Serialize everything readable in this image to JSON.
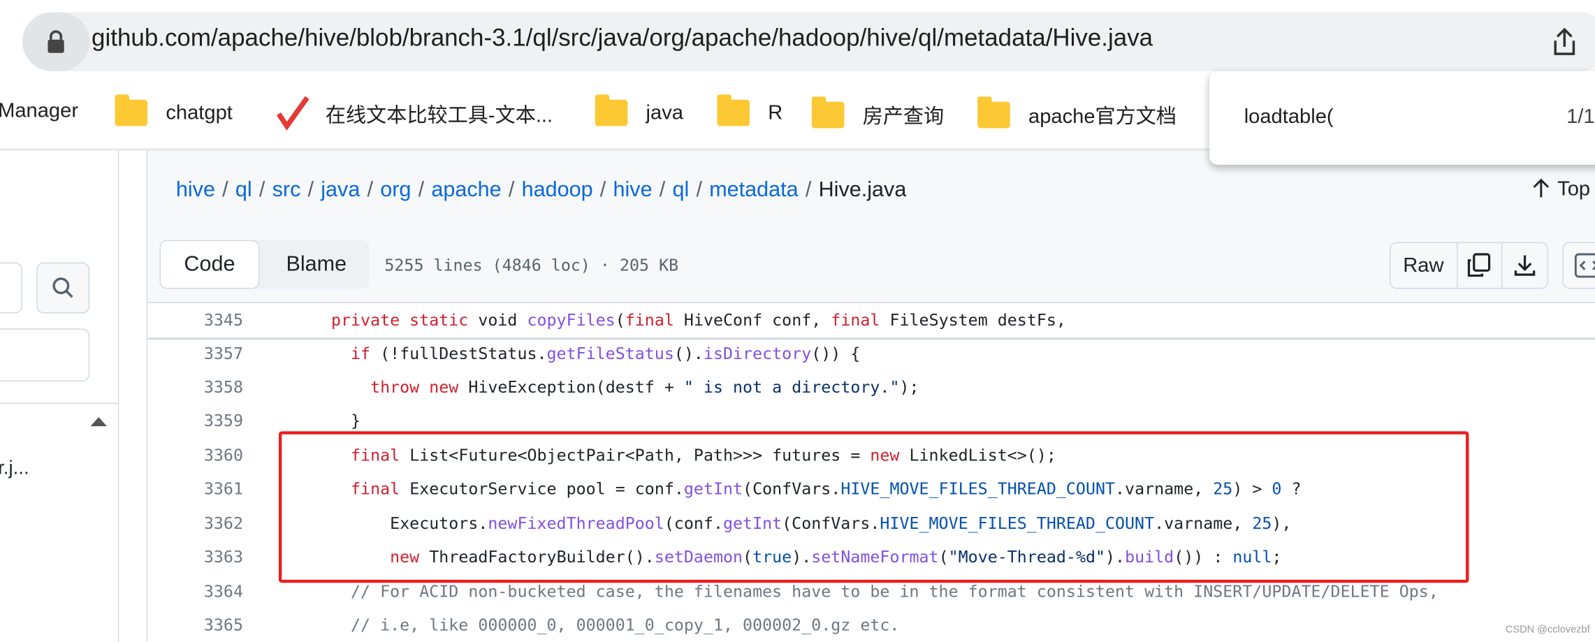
{
  "browser": {
    "url": "github.com/apache/hive/blob/branch-3.1/ql/src/java/org/apache/hadoop/hive/ql/metadata/Hive.java"
  },
  "bookmarks": [
    {
      "label": "Manager",
      "icon": "none"
    },
    {
      "label": "chatgpt",
      "icon": "folder-icon"
    },
    {
      "label": "在线文本比较工具-文本...",
      "icon": "checkmark-icon"
    },
    {
      "label": "java",
      "icon": "folder-icon"
    },
    {
      "label": "R",
      "icon": "folder-icon"
    },
    {
      "label": "房产查询",
      "icon": "folder-icon"
    },
    {
      "label": "apache官方文档",
      "icon": "folder-icon"
    }
  ],
  "find": {
    "query": "loadtable(",
    "count": "1/1"
  },
  "sidebar": {
    "file_item": "r.j..."
  },
  "breadcrumb": [
    "hive",
    "ql",
    "src",
    "java",
    "org",
    "apache",
    "hadoop",
    "hive",
    "ql",
    "metadata"
  ],
  "breadcrumb_current": "Hive.java",
  "top_label": "Top",
  "toolbar": {
    "code": "Code",
    "blame": "Blame",
    "meta": "5255 lines (4846 loc) · 205 KB",
    "raw": "Raw"
  },
  "colors": {
    "keyword": "#cf222e",
    "function": "#8250df",
    "constant": "#0550ae",
    "string": "#0a3069",
    "comment": "#6e7781",
    "highlight_box": "#ee1d1d",
    "link": "#0969da"
  },
  "code": [
    {
      "n": "3345",
      "t": [
        [
          "",
          "    "
        ],
        [
          "kw",
          "private static"
        ],
        [
          "",
          " void "
        ],
        [
          "fn",
          "copyFiles"
        ],
        [
          "",
          "("
        ],
        [
          "kw",
          "final"
        ],
        [
          "",
          " HiveConf conf, "
        ],
        [
          "kw",
          "final"
        ],
        [
          "",
          " FileSystem destFs,"
        ]
      ]
    },
    {
      "n": "3357",
      "t": [
        [
          "",
          "      "
        ],
        [
          "kw",
          "if"
        ],
        [
          "",
          " (!fullDestStatus."
        ],
        [
          "fn",
          "getFileStatus"
        ],
        [
          "",
          "()."
        ],
        [
          "fn",
          "isDirectory"
        ],
        [
          "",
          "()) {"
        ]
      ]
    },
    {
      "n": "3358",
      "t": [
        [
          "",
          "        "
        ],
        [
          "kw",
          "throw new"
        ],
        [
          "",
          " HiveException(destf + "
        ],
        [
          "st",
          "\" is not a directory.\""
        ],
        [
          "",
          ");"
        ]
      ]
    },
    {
      "n": "3359",
      "t": [
        [
          "",
          "      }"
        ]
      ]
    },
    {
      "n": "3360",
      "t": [
        [
          "",
          "      "
        ],
        [
          "kw",
          "final"
        ],
        [
          "",
          " List<Future<ObjectPair<Path, Path>>> futures = "
        ],
        [
          "kw",
          "new"
        ],
        [
          "",
          " LinkedList<>();"
        ]
      ]
    },
    {
      "n": "3361",
      "t": [
        [
          "",
          "      "
        ],
        [
          "kw",
          "final"
        ],
        [
          "",
          " ExecutorService pool = conf."
        ],
        [
          "fn",
          "getInt"
        ],
        [
          "",
          "(ConfVars."
        ],
        [
          "cn",
          "HIVE_MOVE_FILES_THREAD_COUNT"
        ],
        [
          "",
          ".varname, "
        ],
        [
          "cn",
          "25"
        ],
        [
          "",
          ") > "
        ],
        [
          "cn",
          "0"
        ],
        [
          "",
          " ?"
        ]
      ]
    },
    {
      "n": "3362",
      "t": [
        [
          "",
          "          Executors."
        ],
        [
          "fn",
          "newFixedThreadPool"
        ],
        [
          "",
          "(conf."
        ],
        [
          "fn",
          "getInt"
        ],
        [
          "",
          "(ConfVars."
        ],
        [
          "cn",
          "HIVE_MOVE_FILES_THREAD_COUNT"
        ],
        [
          "",
          ".varname, "
        ],
        [
          "cn",
          "25"
        ],
        [
          "",
          "),"
        ]
      ]
    },
    {
      "n": "3363",
      "t": [
        [
          "",
          "          "
        ],
        [
          "kw",
          "new"
        ],
        [
          "",
          " ThreadFactoryBuilder()."
        ],
        [
          "fn",
          "setDaemon"
        ],
        [
          "",
          "("
        ],
        [
          "cn",
          "true"
        ],
        [
          "",
          ")."
        ],
        [
          "fn",
          "setNameFormat"
        ],
        [
          "",
          "("
        ],
        [
          "st",
          "\"Move-Thread-%d\""
        ],
        [
          "",
          ")."
        ],
        [
          "fn",
          "build"
        ],
        [
          "",
          "()) : "
        ],
        [
          "cn",
          "null"
        ],
        [
          "",
          ";"
        ]
      ]
    },
    {
      "n": "3364",
      "t": [
        [
          "",
          "      "
        ],
        [
          "cm",
          "// For ACID non-bucketed case, the filenames have to be in the format consistent with INSERT/UPDATE/DELETE Ops,"
        ]
      ]
    },
    {
      "n": "3365",
      "t": [
        [
          "",
          "      "
        ],
        [
          "cm",
          "// i.e, like 000000_0, 000001_0_copy_1, 000002_0.gz etc."
        ]
      ]
    }
  ],
  "watermark": "CSDN @cclovezbf"
}
